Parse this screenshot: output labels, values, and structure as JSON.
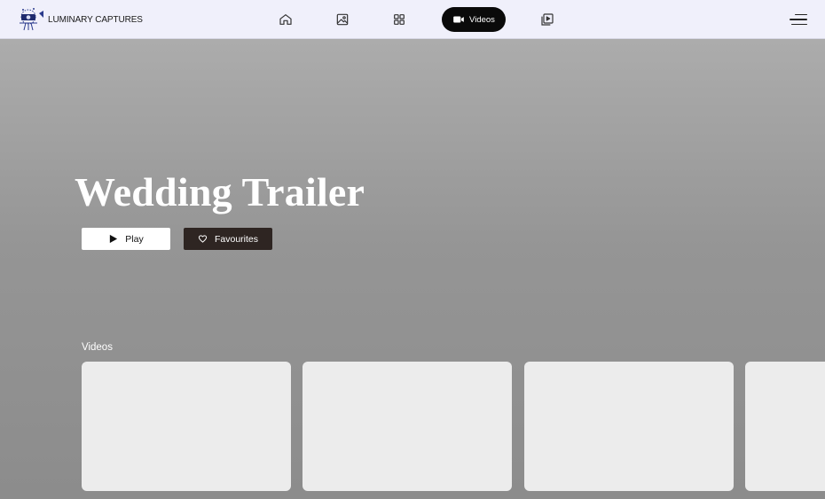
{
  "brand": {
    "name": "LUMINARY CAPTURES"
  },
  "nav": {
    "items": [
      {
        "icon": "home-icon"
      },
      {
        "icon": "image-icon"
      },
      {
        "icon": "grid-icon"
      },
      {
        "icon": "video-camera-icon",
        "label": "Videos",
        "active": true
      },
      {
        "icon": "play-library-icon"
      }
    ]
  },
  "hero": {
    "title": "Wedding Trailer",
    "play_label": "Play",
    "favourites_label": "Favourites"
  },
  "videos_section": {
    "label": "Videos",
    "cards_count_visible": 4
  },
  "colors": {
    "topbar_bg": "#f0f0fb",
    "active_nav_bg": "#0a0a0a",
    "favourites_bg": "#2e2522",
    "card_bg": "#ececec"
  }
}
